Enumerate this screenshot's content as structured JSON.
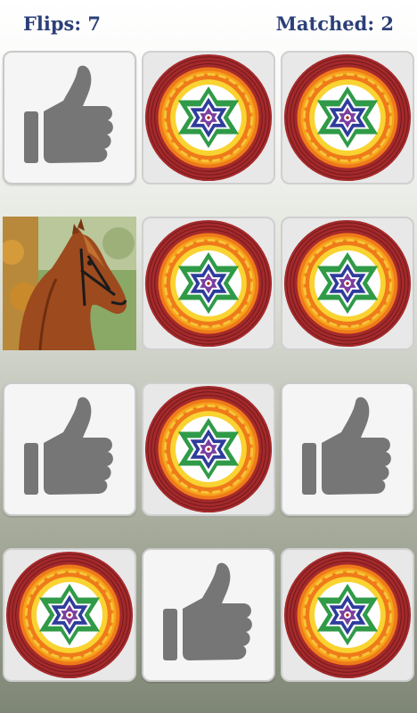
{
  "header": {
    "flips_label": "Flips: 7",
    "matched_label": "Matched: 2"
  },
  "colors": {
    "header_text": "#2b3f78",
    "thumb_icon": "#767676",
    "card_back": "#f5f5f5"
  },
  "cards": [
    {
      "state": "face-down",
      "icon": "thumbs-up-icon"
    },
    {
      "state": "face-up",
      "image": "sri-yantra-mandala"
    },
    {
      "state": "face-up",
      "image": "sri-yantra-mandala"
    },
    {
      "state": "face-up",
      "image": "horse-photo"
    },
    {
      "state": "face-up",
      "image": "sri-yantra-mandala"
    },
    {
      "state": "face-up",
      "image": "sri-yantra-mandala"
    },
    {
      "state": "face-down",
      "icon": "thumbs-up-icon"
    },
    {
      "state": "face-up",
      "image": "sri-yantra-mandala"
    },
    {
      "state": "face-down",
      "icon": "thumbs-up-icon"
    },
    {
      "state": "face-up",
      "image": "sri-yantra-mandala"
    },
    {
      "state": "face-down",
      "icon": "thumbs-up-icon"
    },
    {
      "state": "face-up",
      "image": "sri-yantra-mandala"
    }
  ]
}
